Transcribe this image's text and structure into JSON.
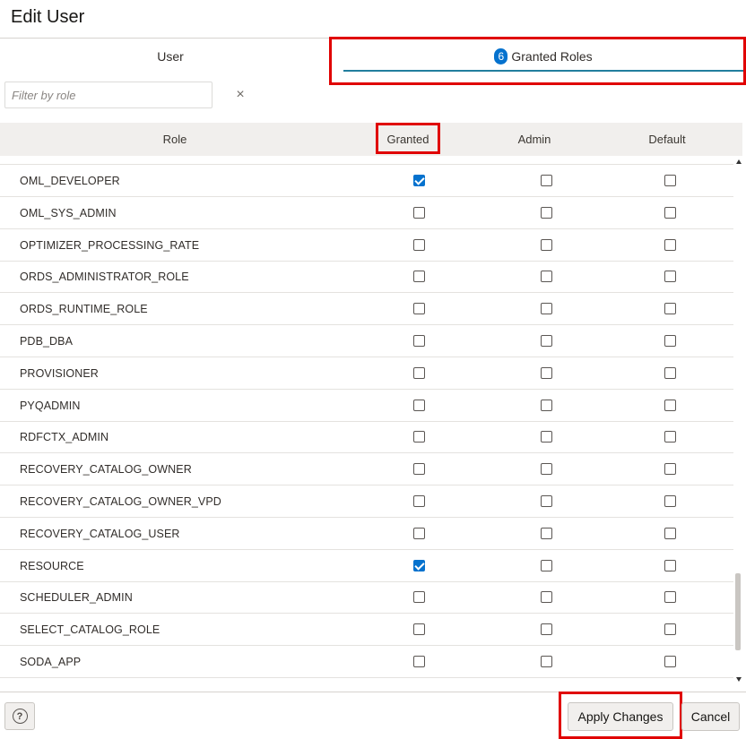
{
  "dialog": {
    "title": "Edit User"
  },
  "tabs": {
    "user_label": "User",
    "roles_badge": "6",
    "roles_label": "Granted Roles"
  },
  "filter": {
    "placeholder": "Filter by role",
    "value": "",
    "clear_symbol": "×"
  },
  "table": {
    "columns": {
      "role": "Role",
      "granted": "Granted",
      "admin": "Admin",
      "default": "Default"
    },
    "rows": [
      {
        "role": "OML_DEVELOPER",
        "granted": true,
        "admin": false,
        "default": false
      },
      {
        "role": "OML_SYS_ADMIN",
        "granted": false,
        "admin": false,
        "default": false
      },
      {
        "role": "OPTIMIZER_PROCESSING_RATE",
        "granted": false,
        "admin": false,
        "default": false
      },
      {
        "role": "ORDS_ADMINISTRATOR_ROLE",
        "granted": false,
        "admin": false,
        "default": false
      },
      {
        "role": "ORDS_RUNTIME_ROLE",
        "granted": false,
        "admin": false,
        "default": false
      },
      {
        "role": "PDB_DBA",
        "granted": false,
        "admin": false,
        "default": false
      },
      {
        "role": "PROVISIONER",
        "granted": false,
        "admin": false,
        "default": false
      },
      {
        "role": "PYQADMIN",
        "granted": false,
        "admin": false,
        "default": false
      },
      {
        "role": "RDFCTX_ADMIN",
        "granted": false,
        "admin": false,
        "default": false
      },
      {
        "role": "RECOVERY_CATALOG_OWNER",
        "granted": false,
        "admin": false,
        "default": false
      },
      {
        "role": "RECOVERY_CATALOG_OWNER_VPD",
        "granted": false,
        "admin": false,
        "default": false
      },
      {
        "role": "RECOVERY_CATALOG_USER",
        "granted": false,
        "admin": false,
        "default": false
      },
      {
        "role": "RESOURCE",
        "granted": true,
        "admin": false,
        "default": false
      },
      {
        "role": "SCHEDULER_ADMIN",
        "granted": false,
        "admin": false,
        "default": false
      },
      {
        "role": "SELECT_CATALOG_ROLE",
        "granted": false,
        "admin": false,
        "default": false
      },
      {
        "role": "SODA_APP",
        "granted": false,
        "admin": false,
        "default": false
      },
      {
        "role": "",
        "granted": false,
        "admin": false,
        "default": false
      }
    ]
  },
  "footer": {
    "help_symbol": "?",
    "apply_label": "Apply Changes",
    "cancel_label": "Cancel"
  },
  "colors": {
    "accent": "#0572ce",
    "highlight": "#e00000",
    "header_bg": "#f1efed"
  },
  "icons": {
    "help": "help-circle-icon",
    "clear": "close-icon",
    "check": "checkmark-icon"
  }
}
